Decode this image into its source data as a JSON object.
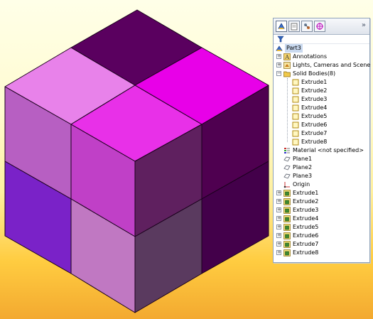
{
  "panel": {
    "tabs": [
      {
        "icon": "feature-manager-icon",
        "active": true
      },
      {
        "icon": "property-manager-icon",
        "active": false
      },
      {
        "icon": "configuration-manager-icon",
        "active": false
      },
      {
        "icon": "dimxpert-manager-icon",
        "active": false
      }
    ],
    "expand_glyph": "»",
    "filter_icon": "filter-icon"
  },
  "tree": {
    "part": "Part3",
    "annotations": "Annotations",
    "lights": "Lights, Cameras and Scene",
    "solid_bodies": "Solid Bodies(8)",
    "bodies": [
      "Extrude1",
      "Extrude2",
      "Extrude3",
      "Extrude4",
      "Extrude5",
      "Extrude6",
      "Extrude7",
      "Extrude8"
    ],
    "material": "Material <not specified>",
    "planes": [
      "Plane1",
      "Plane2",
      "Plane3"
    ],
    "origin": "Origin",
    "features": [
      "Extrude1",
      "Extrude2",
      "Extrude3",
      "Extrude4",
      "Extrude5",
      "Extrude6",
      "Extrude7",
      "Extrude8"
    ]
  },
  "cube_colors": {
    "top_back": "#5a005f",
    "top_left": "#e882ea",
    "top_right": "#e800e8",
    "top_front": "#e830e8",
    "left_upper_back": "#b75fc2",
    "left_upper_front": "#c040c7",
    "left_lower_back": "#7a22c8",
    "left_lower_front": "#c078c2",
    "right_upper_front": "#5f205f",
    "right_upper_back": "#4f0050",
    "right_lower_front": "#5a3a5f",
    "right_lower_back": "#43004a"
  }
}
